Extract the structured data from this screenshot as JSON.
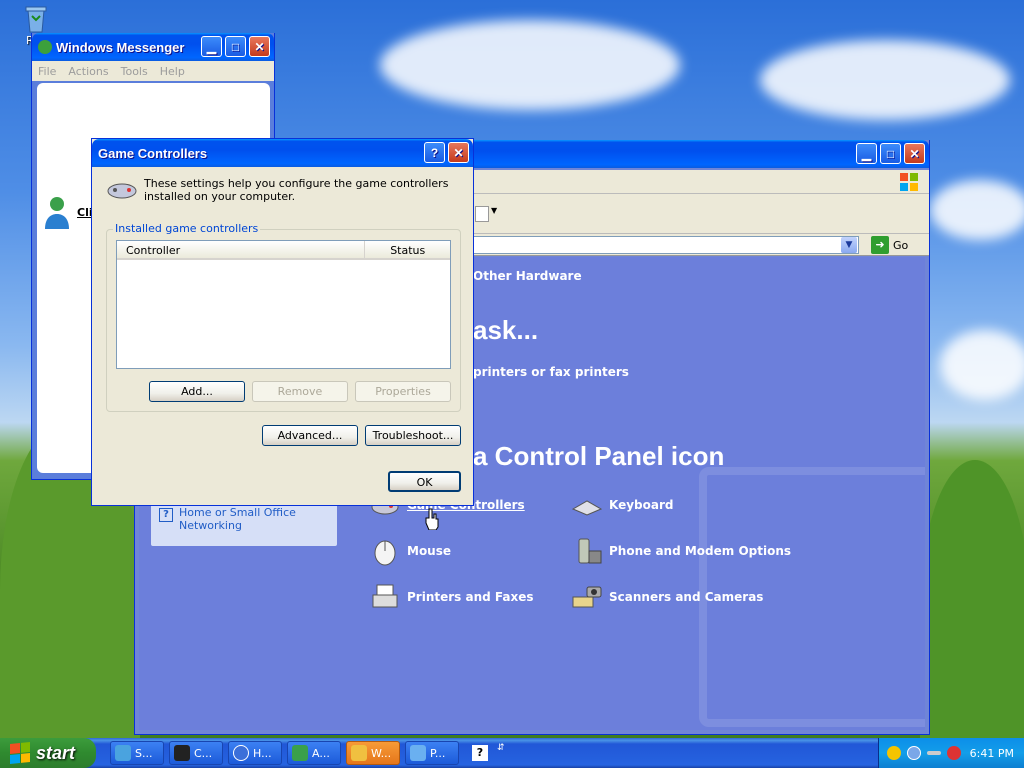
{
  "desktop": {
    "icons": [
      {
        "label": "Rec",
        "name": "recycle-bin-icon"
      }
    ]
  },
  "messenger": {
    "title": "Windows Messenger",
    "menu": [
      "File",
      "Actions",
      "Tools",
      "Help"
    ],
    "signin_text": "Clic"
  },
  "control_panel": {
    "breadcrumb": "Other Hardware",
    "pick_task": "ask...",
    "task_link": "printers or fax printers",
    "pick_icon": "a Control Panel icon",
    "see_also": {
      "label": "Home or Small Office Networking"
    },
    "go_label": "Go",
    "items": [
      {
        "label": "Game Controllers",
        "icon": "game-controller-icon"
      },
      {
        "label": "Keyboard",
        "icon": "keyboard-icon"
      },
      {
        "label": "Mouse",
        "icon": "mouse-icon"
      },
      {
        "label": "Phone and Modem Options",
        "icon": "phone-icon"
      },
      {
        "label": "Printers and Faxes",
        "icon": "printer-icon"
      },
      {
        "label": "Scanners and Cameras",
        "icon": "scanner-icon"
      }
    ]
  },
  "game_dialog": {
    "title": "Game Controllers",
    "intro": "These settings help you configure the game controllers installed on your computer.",
    "group_label": "Installed game controllers",
    "columns": [
      "Controller",
      "Status"
    ],
    "rows": [],
    "buttons": {
      "add": "Add...",
      "remove": "Remove",
      "properties": "Properties",
      "advanced": "Advanced...",
      "troubleshoot": "Troubleshoot...",
      "ok": "OK"
    }
  },
  "taskbar": {
    "start_label": "start",
    "buttons": [
      {
        "label": "S...",
        "icon": "search-icon",
        "color": "#4aa3df"
      },
      {
        "label": "C...",
        "icon": "cmd-icon",
        "color": "#222222"
      },
      {
        "label": "H...",
        "icon": "help-icon",
        "color": "#3b6fd9"
      },
      {
        "label": "A...",
        "icon": "app-icon",
        "color": "#3aa04a"
      },
      {
        "label": "W...",
        "icon": "windows-icon",
        "color": "#f0c040",
        "active": true
      },
      {
        "label": "P...",
        "icon": "panel-icon",
        "color": "#6ab0f0"
      }
    ],
    "clock": "6:41 PM"
  },
  "colors": {
    "xp_blue": "#0053ee",
    "cp_background": "#6c7fdb",
    "link": "#215dc6"
  }
}
